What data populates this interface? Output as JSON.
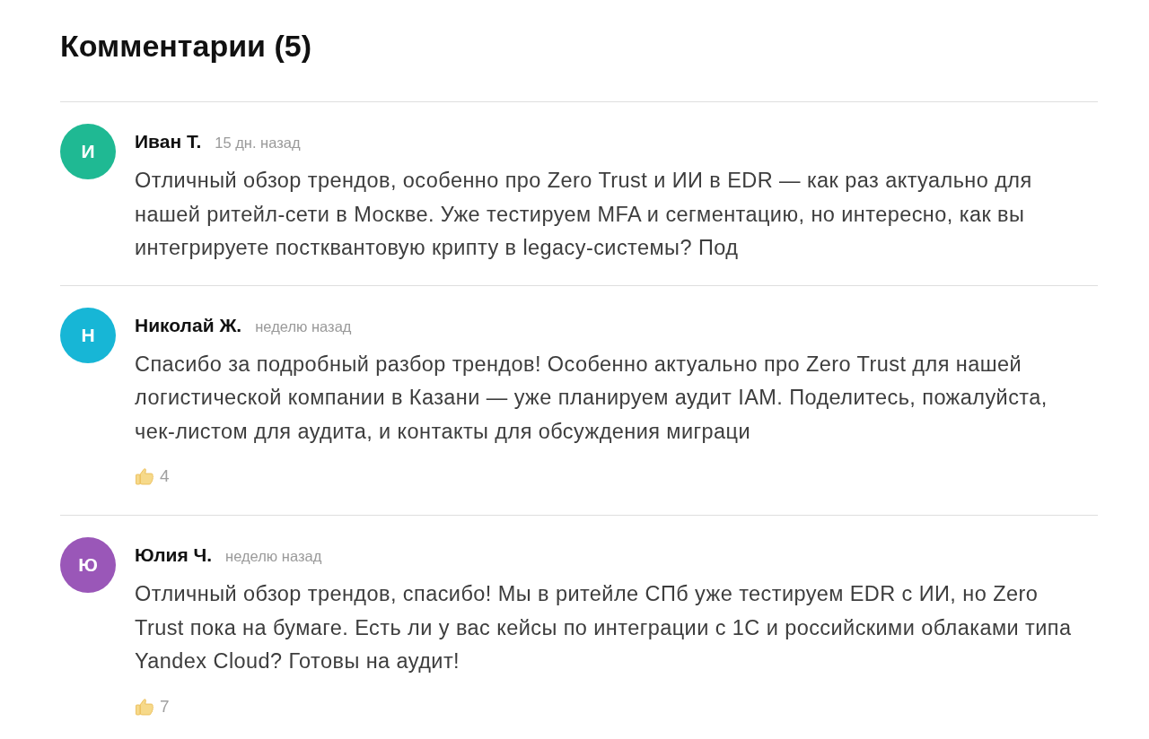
{
  "title": "Комментарии (5)",
  "comments": [
    {
      "avatar": {
        "letter": "И",
        "color": "#1fb993"
      },
      "author": "Иван Т.",
      "time": "15 дн. назад",
      "text": "Отличный обзор трендов, особенно про Zero Trust и ИИ в EDR — как раз актуально для нашей ритейл-сети в Москве. Уже тестируем MFA и сегментацию, но интересно, как вы интегрируете постквантовую крипту в legacy-системы? Под"
    },
    {
      "avatar": {
        "letter": "Н",
        "color": "#17b6d6"
      },
      "author": "Николай Ж.",
      "time": "неделю назад",
      "text": "Спасибо за подробный разбор трендов! Особенно актуально про Zero Trust для нашей логистической компании в Казани — уже планируем аудит IAM. Поделитесь, пожалуйста, чек-листом для аудита, и контакты для обсуждения миграци",
      "likes": "4"
    },
    {
      "avatar": {
        "letter": "Ю",
        "color": "#9a57b8"
      },
      "author": "Юлия Ч.",
      "time": "неделю назад",
      "text": "Отличный обзор трендов, спасибо! Мы в ритейле СПб уже тестируем EDR с ИИ, но Zero Trust пока на бумаге. Есть ли у вас кейсы по интеграции с 1С и российскими облаками типа Yandex Cloud? Готовы на аудит!",
      "likes": "7"
    }
  ]
}
